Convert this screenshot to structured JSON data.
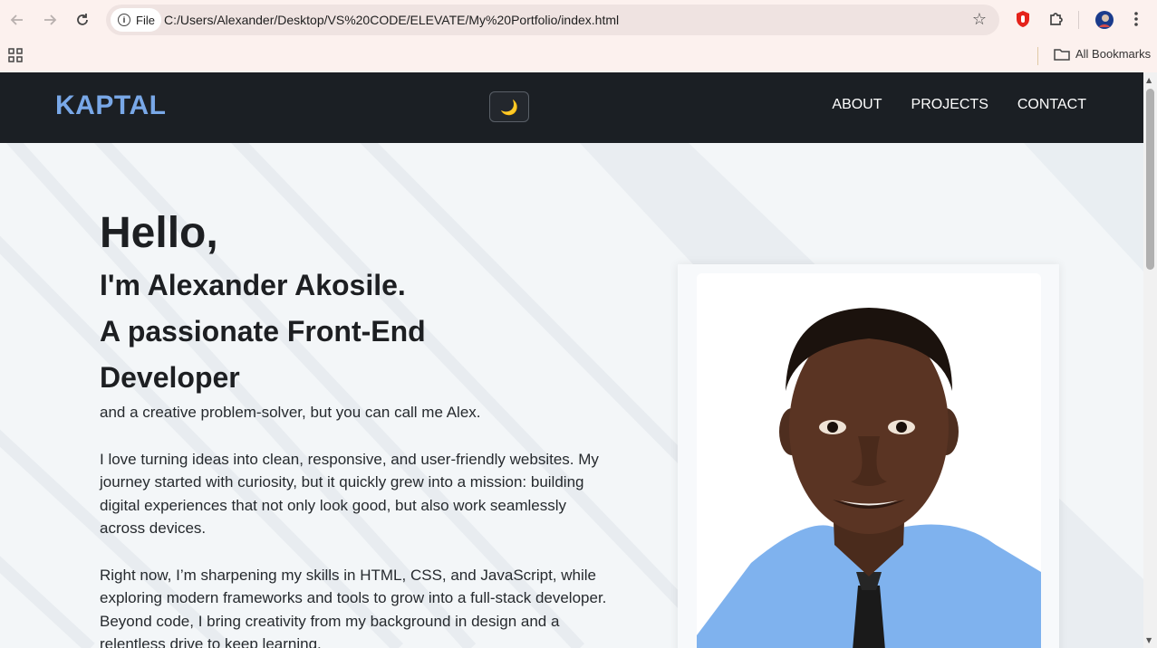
{
  "browser": {
    "file_label": "File",
    "url": "C:/Users/Alexander/Desktop/VS%20CODE/ELEVATE/My%20Portfolio/index.html",
    "bookmarks_label": "All Bookmarks"
  },
  "nav": {
    "logo": "KAPTAL",
    "theme_icon": "🌙",
    "links": [
      "ABOUT",
      "PROJECTS",
      "CONTACT"
    ]
  },
  "hero": {
    "greeting": "Hello,",
    "intro_line1": "I'm Alexander Akosile.",
    "intro_line2": "A passionate Front-End",
    "intro_line3": "Developer",
    "tagline": "and a creative problem-solver, but you can call me Alex.",
    "para1": "I love turning ideas into clean, responsive, and user-friendly websites. My journey started with curiosity, but it quickly grew into a mission: building digital experiences that not only look good, but also work seamlessly across devices.",
    "para2": "Right now, I’m sharpening my skills in HTML, CSS, and JavaScript, while exploring modern frameworks and tools to grow into a full-stack developer. Beyond code, I bring creativity from my background in design and a relentless drive to keep learning."
  },
  "colors": {
    "navbar_bg": "#1b1f24",
    "logo": "#79a8e8",
    "page_bg": "#f3f6f8",
    "shirt": "#7fb2ee"
  }
}
